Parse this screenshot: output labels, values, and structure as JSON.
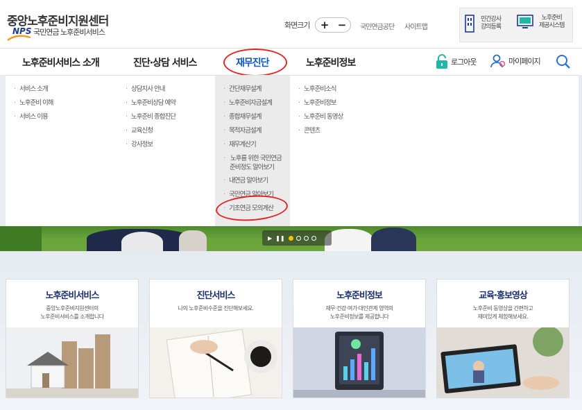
{
  "header": {
    "logo_title": "중앙노후준비지원센터",
    "logo_nps": "NPS",
    "logo_subtitle": "국민연금 노후준비서비스",
    "font_size_label": "화면크기",
    "font_plus": "+",
    "font_minus": "−",
    "link_nps": "국민연금공단",
    "link_sitemap": "사이트맵",
    "util_lecturer_line1": "민간강사",
    "util_lecturer_line2": "강의등록",
    "util_system_line1": "노후준비",
    "util_system_line2": "제공시스템"
  },
  "nav": {
    "items": [
      {
        "label": "노후준비서비스 소개"
      },
      {
        "label": "진단·상담 서비스"
      },
      {
        "label": "재무진단"
      },
      {
        "label": "노후준비정보"
      }
    ],
    "logout": "로그아웃",
    "mypage": "마이페이지"
  },
  "mega_menu": {
    "col1": [
      "서비스 소개",
      "노후준비 이해",
      "서비스 이용"
    ],
    "col2": [
      "상담지사 안내",
      "노후준비상담 예약",
      "노후준비 종합진단",
      "교육신청",
      "강사정보"
    ],
    "col3": [
      "간단재무설계",
      "노후준비자금설계",
      "종합재무설계",
      "목적자금설계",
      "재무계산기",
      "노후를 위한 국민연금",
      "준비정도 알아보기",
      "내연금 알아보기",
      "국민연금 알아보기",
      "기초연금 모의계산"
    ],
    "col4": [
      "노후준비소식",
      "노후준비정보",
      "노후준비 동영상",
      "콘텐츠"
    ]
  },
  "slider": {
    "play": "▶",
    "pause": "❚❚"
  },
  "cards": [
    {
      "title": "노후준비서비스",
      "desc1": "중앙노후준비지원센터의",
      "desc2": "노후준비서비스를 소개합니다"
    },
    {
      "title": "진단서비스",
      "desc1": "나의 노후준비수준을 진단해보세요.",
      "desc2": ""
    },
    {
      "title": "노후준비정보",
      "desc1": "재무·건강·여가·대인관계 영역의",
      "desc2": "노후준비정보를 제공합니다"
    },
    {
      "title": "교육·홍보영상",
      "desc1": "노후준비 동영상을 간편하고",
      "desc2": "재미있게 체험해보세요."
    }
  ],
  "colors": {
    "active_nav": "#0d55c6",
    "annotation": "#e32424",
    "card_title": "#1a2e6b",
    "logout_icon": "#1fb8a6",
    "mypage_icon": "#2b6fd8"
  }
}
